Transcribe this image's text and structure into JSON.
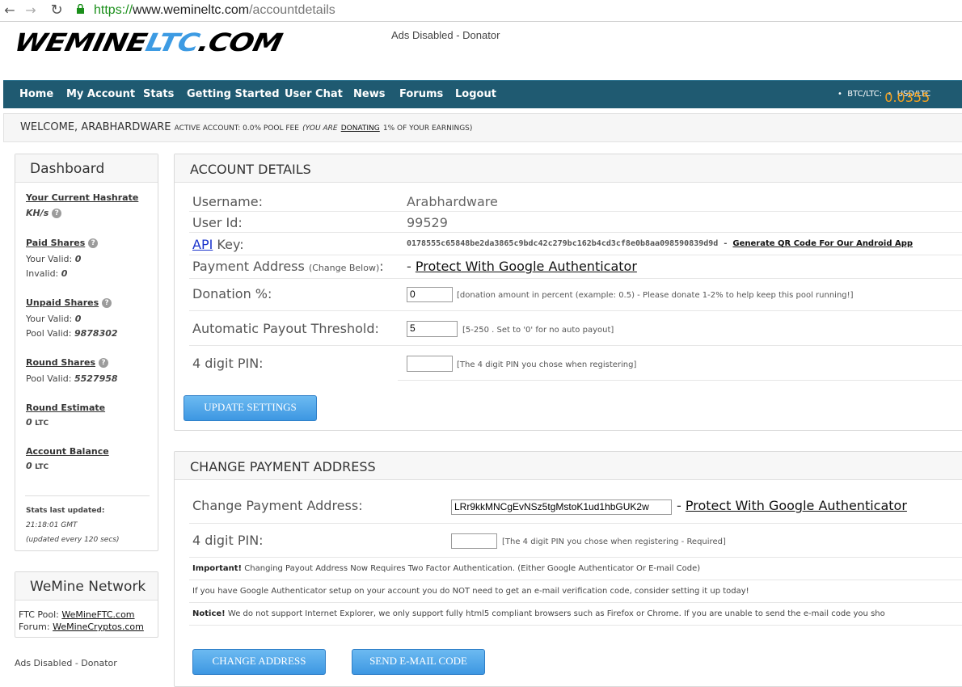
{
  "browser": {
    "url_scheme": "https://",
    "url_host": "www.wemineltc.com",
    "url_path": "/accountdetails"
  },
  "header": {
    "logo_part1": "WEMINE",
    "logo_part2": "LTC",
    "logo_part3": ".COM",
    "ads_status": "Ads Disabled - Donator"
  },
  "nav": {
    "items": [
      "Home",
      "My Account",
      "Stats",
      "Getting Started",
      "User Chat",
      "News",
      "Forums",
      "Logout"
    ],
    "btc_label": "BTC/LTC:",
    "btc_value": "0.0355",
    "usd_label": "USD/LTC"
  },
  "welcome": {
    "text": "WELCOME, ARABHARDWARE",
    "status_prefix": "ACTIVE ACCOUNT: 0.0% POOL FEE",
    "donating_prefix": "(YOU ARE",
    "donating_link": "DONATING",
    "donating_suffix": "1% OF YOUR EARNINGS)"
  },
  "dashboard": {
    "title": "Dashboard",
    "hashrate_label": "Your Current Hashrate",
    "hashrate_unit": "KH/s",
    "paid_shares_label": "Paid Shares",
    "paid_valid_label": "Your Valid:",
    "paid_valid_value": "0",
    "invalid_label": "Invalid:",
    "invalid_value": "0",
    "unpaid_shares_label": "Unpaid Shares",
    "unpaid_valid_label": "Your Valid:",
    "unpaid_valid_value": "0",
    "pool_valid_label": "Pool Valid:",
    "pool_valid_value": "9878302",
    "round_shares_label": "Round Shares",
    "round_pool_valid_label": "Pool Valid:",
    "round_pool_valid_value": "5527958",
    "round_estimate_label": "Round Estimate",
    "round_estimate_value": "0",
    "round_estimate_unit": "LTC",
    "balance_label": "Account Balance",
    "balance_value": "0",
    "balance_unit": "LTC",
    "updated_label": "Stats last updated:",
    "updated_time": "21:18:01 GMT",
    "updated_interval": "(updated every 120 secs)",
    "help_glyph": "?"
  },
  "network": {
    "title": "WeMine Network",
    "ftc_label": "FTC Pool:",
    "ftc_link": "WeMineFTC.com",
    "forum_label": "Forum:",
    "forum_link": "WeMineCryptos.com"
  },
  "footer": {
    "ads_status": "Ads Disabled - Donator"
  },
  "account_details": {
    "title": "ACCOUNT DETAILS",
    "username_label": "Username:",
    "username_value": "Arabhardware",
    "userid_label": "User Id:",
    "userid_value": "99529",
    "api_link": "API",
    "api_label": "Key:",
    "api_key": "0178555c65848be2da3865c9bdc42c279bc162b4cd3cf8e0b8aa098590839d9d",
    "api_sep": "-",
    "qr_link": "Generate QR Code For Our Android App",
    "payment_label": "Payment Address",
    "payment_note": "(Change Below)",
    "payment_colon": ":",
    "payment_dash": "-",
    "payment_gauth": "Protect With Google Authenticator",
    "donation_label": "Donation %:",
    "donation_value": "0",
    "donation_hint": "[donation amount in percent (example: 0.5) - Please donate 1-2% to help keep this pool running!]",
    "payout_label": "Automatic Payout Threshold:",
    "payout_value": "5",
    "payout_hint": "[5-250 . Set to '0' for no auto payout]",
    "pin_label": "4 digit PIN:",
    "pin_hint": "[The 4 digit PIN you chose when registering]",
    "update_button": "UPDATE SETTINGS"
  },
  "change_payment": {
    "title": "CHANGE PAYMENT ADDRESS",
    "address_label": "Change Payment Address:",
    "address_value": "LRr9kkMNCgEvNSz5tgMstoK1ud1hbGUK2w",
    "address_dash": "-",
    "gauth_link": "Protect With Google Authenticator",
    "pin_label": "4 digit PIN:",
    "pin_hint": "[The 4 digit PIN you chose when registering - Required]",
    "important_label": "Important!",
    "important_text": "Changing Payout Address Now Requires Two Factor Authentication. (Either Google Authenticator Or E-mail Code)",
    "gauth_note": "If you have Google Authenticator setup on your account you do NOT need to get an e-mail verification code, consider setting it up today!",
    "notice_label": "Notice!",
    "notice_text": "We do not support Internet Explorer, we only support fully html5 compliant browsers such as Firefox or Chrome. If you are unable to send the e-mail code you sho",
    "change_button": "CHANGE ADDRESS",
    "email_button": "SEND E-MAIL CODE"
  }
}
